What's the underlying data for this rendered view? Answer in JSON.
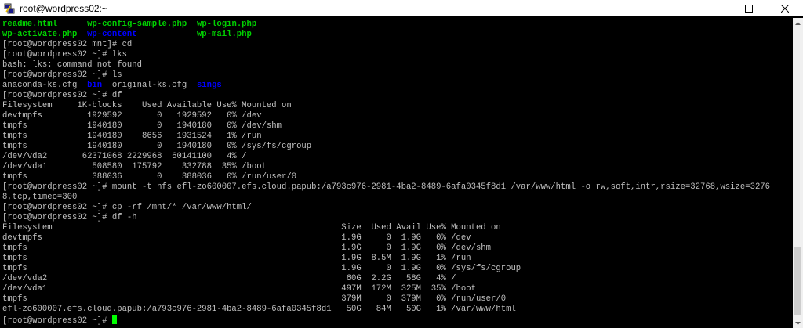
{
  "window": {
    "title": "root@wordpress02:~",
    "app_icon": "putty-icon",
    "controls": [
      "minimize-icon",
      "maximize-icon",
      "close-icon"
    ]
  },
  "colors": {
    "background": "#000000",
    "text": "#c0c0c0",
    "file_green": "#00d000",
    "dir_blue": "#0000ff",
    "cursor": "#00ff00"
  },
  "terminal": {
    "lines": [
      [
        {
          "t": "readme.html",
          "c": "green"
        },
        {
          "t": "      "
        },
        {
          "t": "wp-config-sample.php",
          "c": "green"
        },
        {
          "t": "  "
        },
        {
          "t": "wp-login.php",
          "c": "green"
        }
      ],
      [
        {
          "t": "wp-activate.php",
          "c": "green"
        },
        {
          "t": "  "
        },
        {
          "t": "wp-content",
          "c": "blue"
        },
        {
          "t": "            "
        },
        {
          "t": "wp-mail.php",
          "c": "green"
        }
      ],
      [
        {
          "t": "[root@wordpress02 mnt]# cd"
        }
      ],
      [
        {
          "t": "[root@wordpress02 ~]# lks"
        }
      ],
      [
        {
          "t": "bash: lks: command not found"
        }
      ],
      [
        {
          "t": "[root@wordpress02 ~]# ls"
        }
      ],
      [
        {
          "t": "anaconda-ks.cfg  "
        },
        {
          "t": "bin",
          "c": "blue"
        },
        {
          "t": "  original-ks.cfg  "
        },
        {
          "t": "sings",
          "c": "blue"
        }
      ],
      [
        {
          "t": "[root@wordpress02 ~]# df"
        }
      ],
      [
        {
          "t": "Filesystem     1K-blocks    Used Available Use% Mounted on"
        }
      ],
      [
        {
          "t": "devtmpfs         1929592       0   1929592   0% /dev"
        }
      ],
      [
        {
          "t": "tmpfs            1940180       0   1940180   0% /dev/shm"
        }
      ],
      [
        {
          "t": "tmpfs            1940180    8656   1931524   1% /run"
        }
      ],
      [
        {
          "t": "tmpfs            1940180       0   1940180   0% /sys/fs/cgroup"
        }
      ],
      [
        {
          "t": "/dev/vda2       62371068 2229968  60141100   4% /"
        }
      ],
      [
        {
          "t": "/dev/vda1         508580  175792    332788  35% /boot"
        }
      ],
      [
        {
          "t": "tmpfs             388036       0    388036   0% /run/user/0"
        }
      ],
      [
        {
          "t": "[root@wordpress02 ~]# mount -t nfs efl-zo600007.efs.cloud.papub:/a793c976-2981-4ba2-8489-6afa0345f8d1 /var/www/html -o rw,soft,intr,rsize=32768,wsize=3276"
        }
      ],
      [
        {
          "t": "8,tcp,timeo=300"
        }
      ],
      [
        {
          "t": "[root@wordpress02 ~]# cp -rf /mnt/* /var/www/html/"
        }
      ],
      [
        {
          "t": "[root@wordpress02 ~]# df -h"
        }
      ],
      [
        {
          "t": "Filesystem                                                          Size  Used Avail Use% Mounted on"
        }
      ],
      [
        {
          "t": "devtmpfs                                                            1.9G     0  1.9G   0% /dev"
        }
      ],
      [
        {
          "t": "tmpfs                                                               1.9G     0  1.9G   0% /dev/shm"
        }
      ],
      [
        {
          "t": "tmpfs                                                               1.9G  8.5M  1.9G   1% /run"
        }
      ],
      [
        {
          "t": "tmpfs                                                               1.9G     0  1.9G   0% /sys/fs/cgroup"
        }
      ],
      [
        {
          "t": "/dev/vda2                                                            60G  2.2G   58G   4% /"
        }
      ],
      [
        {
          "t": "/dev/vda1                                                           497M  172M  325M  35% /boot"
        }
      ],
      [
        {
          "t": "tmpfs                                                               379M     0  379M   0% /run/user/0"
        }
      ],
      [
        {
          "t": "efl-zo600007.efs.cloud.papub:/a793c976-2981-4ba2-8489-6afa0345f8d1   50G   84M   50G   1% /var/www/html"
        }
      ],
      [
        {
          "t": "[root@wordpress02 ~]# "
        }
      ]
    ]
  }
}
